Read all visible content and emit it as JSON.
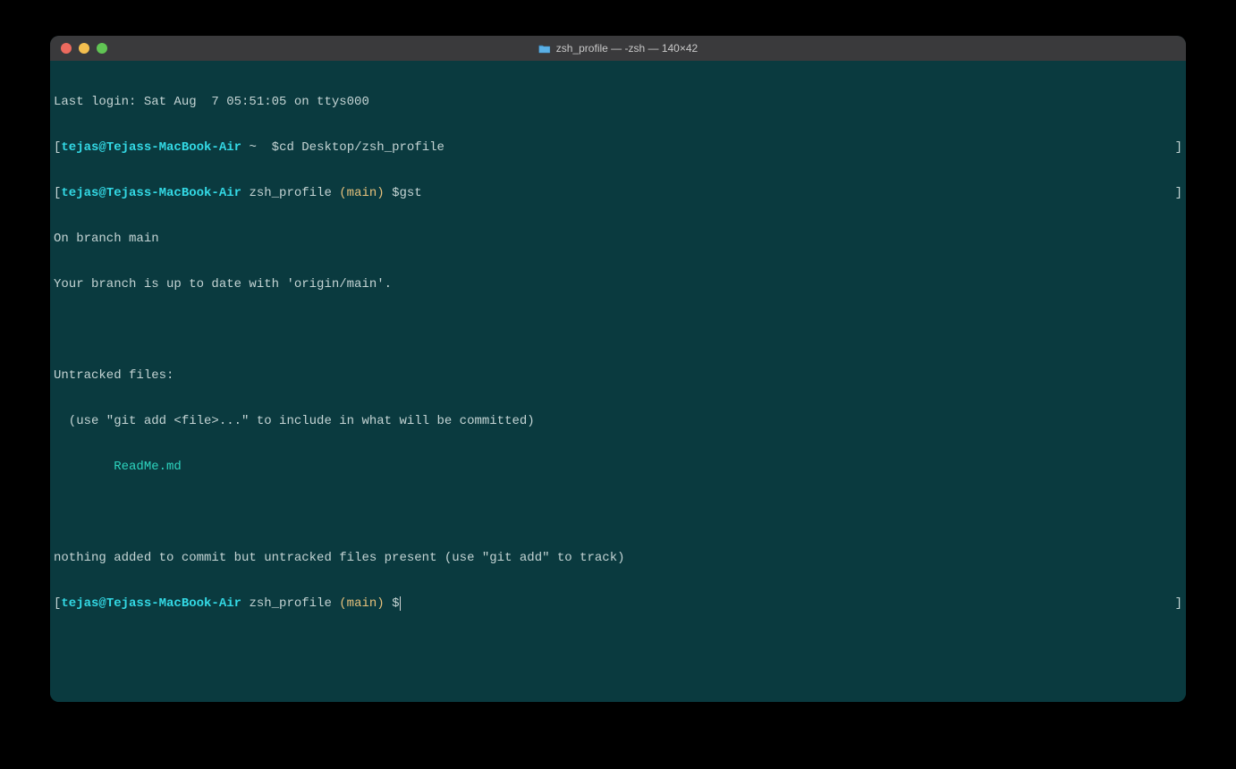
{
  "window": {
    "title": "zsh_profile — -zsh — 140×42"
  },
  "terminal": {
    "last_login": "Last login: Sat Aug  7 05:51:05 on ttys000",
    "line1": {
      "bracket_open": "[",
      "user_host": "tejas@Tejass-MacBook-Air",
      "path": " ~ ",
      "prompt": " $",
      "command": "cd Desktop/zsh_profile",
      "bracket_close": "]"
    },
    "line2": {
      "bracket_open": "[",
      "user_host": "tejas@Tejass-MacBook-Air",
      "path": " zsh_profile ",
      "branch": "(main)",
      "prompt": " $",
      "command": "gst",
      "bracket_close": "]"
    },
    "gst_output": {
      "on_branch": "On branch main",
      "up_to_date": "Your branch is up to date with 'origin/main'.",
      "blank1": "",
      "untracked_header": "Untracked files:",
      "untracked_hint": "  (use \"git add <file>...\" to include in what will be committed)",
      "untracked_file": "\tReadMe.md",
      "blank2": "",
      "nothing_added": "nothing added to commit but untracked files present (use \"git add\" to track)"
    },
    "line3": {
      "bracket_open": "[",
      "user_host": "tejas@Tejass-MacBook-Air",
      "path": " zsh_profile ",
      "branch": "(main)",
      "prompt": " $",
      "bracket_close": "]"
    }
  }
}
